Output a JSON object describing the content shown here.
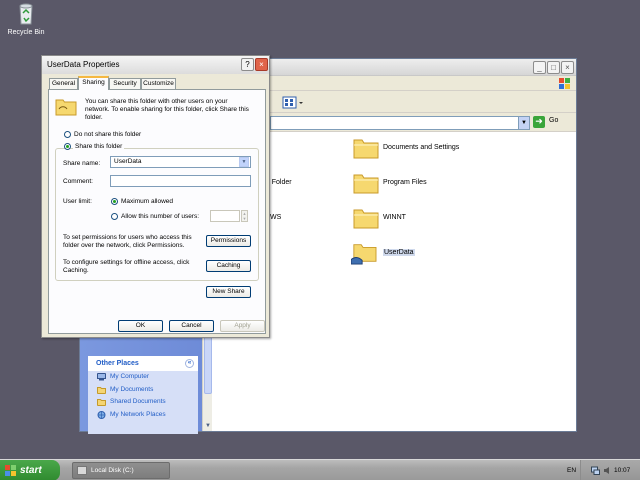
{
  "desktop": {
    "icons": [
      {
        "label": "Recycle Bin",
        "icon": "recycle-bin-icon"
      }
    ]
  },
  "explorer": {
    "title": "",
    "address": {
      "value": "",
      "go_label": "Go"
    },
    "views_icon": "views-icon",
    "task_pane": {
      "other_places": {
        "header": "Other Places",
        "items": [
          {
            "label": "My Computer",
            "icon": "my-computer-icon"
          },
          {
            "label": "My Documents",
            "icon": "folder-icon"
          },
          {
            "label": "Shared Documents",
            "icon": "folder-icon"
          },
          {
            "label": "My Network Places",
            "icon": "network-places-icon"
          }
        ]
      }
    },
    "items": [
      {
        "label": "Documents and Settings",
        "icon": "folder-icon"
      },
      {
        "label": "Program Files",
        "icon": "folder-icon"
      },
      {
        "label": "WINNT",
        "icon": "folder-icon"
      },
      {
        "label": "UserData",
        "icon": "shared-folder-icon",
        "selected": true
      }
    ],
    "partial_labels": [
      "ed Folder",
      "WS"
    ]
  },
  "dialog": {
    "title": "UserData Properties",
    "tabs": [
      {
        "label": "General",
        "active": false
      },
      {
        "label": "Sharing",
        "active": true
      },
      {
        "label": "Security",
        "active": false
      },
      {
        "label": "Customize",
        "active": false
      }
    ],
    "intro_lines": [
      "You can share this folder with other users on your",
      "network. To enable sharing for this folder, click Share this",
      "folder."
    ],
    "radio_not_share": "Do not share this folder",
    "radio_share": "Share this folder",
    "share_name_label": "Share name:",
    "share_name_value": "UserData",
    "comment_label": "Comment:",
    "comment_value": "",
    "user_limit_label": "User limit:",
    "max_allowed": "Maximum allowed",
    "allow_number": "Allow this number of users:",
    "permissions_lines": [
      "To set permissions for users who access this",
      "folder over the network, click Permissions."
    ],
    "permissions_button": "Permissions",
    "caching_lines": [
      "To configure settings for offline access, click",
      "Caching."
    ],
    "caching_button": "Caching",
    "new_share_button": "New Share",
    "ok_button": "OK",
    "cancel_button": "Cancel",
    "apply_button": "Apply"
  },
  "taskbar": {
    "start_label": "start",
    "tasks": [
      {
        "label": "Local Disk (C:)"
      }
    ],
    "language": "EN",
    "clock": "10:07"
  }
}
